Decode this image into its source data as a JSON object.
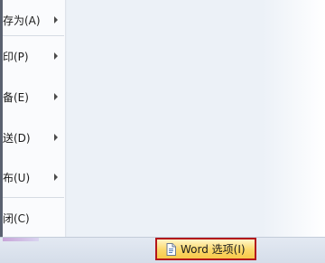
{
  "office_menu": {
    "items": [
      {
        "label": "存为(A)",
        "has_submenu": true
      },
      {
        "label": "印(P)",
        "has_submenu": true
      },
      {
        "label": "备(E)",
        "has_submenu": true
      },
      {
        "label": "送(D)",
        "has_submenu": true
      },
      {
        "label": "布(U)",
        "has_submenu": true
      },
      {
        "label": "闭(C)",
        "has_submenu": false
      }
    ]
  },
  "footer": {
    "word_options_label": "Word 选项(I)"
  },
  "icons": {
    "submenu_arrow": "chevron-right-icon",
    "word_options": "document-options-icon"
  },
  "colors": {
    "highlight_border": "#b3161b",
    "button_fill": "#fbd86a",
    "panel_bg": "#ecf1f7"
  }
}
